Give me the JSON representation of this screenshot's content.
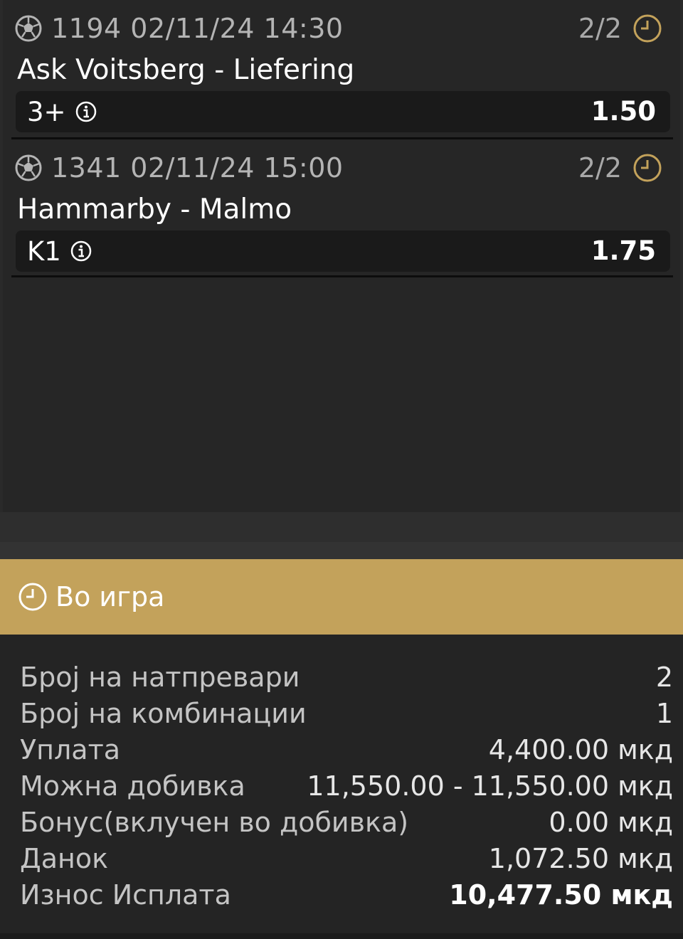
{
  "colors": {
    "accent_gold": "#c3a25b",
    "background": "#262626",
    "pick_background": "#1a1a1a",
    "muted_text": "#b4b4b4"
  },
  "matches": [
    {
      "sport_icon": "soccer-ball-icon",
      "meta": "1194 02/11/24 14:30",
      "status": "2/2",
      "status_icon": "clock-icon",
      "teams": "Ask Voitsberg - Liefering",
      "pick": "3+",
      "odds": "1.50"
    },
    {
      "sport_icon": "soccer-ball-icon",
      "meta": "1341 02/11/24 15:00",
      "status": "2/2",
      "status_icon": "clock-icon",
      "teams": "Hammarby - Malmo",
      "pick": "K1",
      "odds": "1.75"
    }
  ],
  "banner": {
    "icon": "clock-icon",
    "label": "Во игра"
  },
  "summary": [
    {
      "label": "Број на натпревари",
      "value": "2"
    },
    {
      "label": "Број на комбинации",
      "value": "1"
    },
    {
      "label": "Уплата",
      "value": "4,400.00 мкд"
    },
    {
      "label": "Можна добивка",
      "value": "11,550.00 - 11,550.00 мкд"
    },
    {
      "label": "Бонус(вклучен во добивка)",
      "value": "0.00 мкд"
    },
    {
      "label": "Данок",
      "value": "1,072.50 мкд"
    },
    {
      "label": "Износ Исплата",
      "value": "10,477.50 мкд"
    }
  ]
}
